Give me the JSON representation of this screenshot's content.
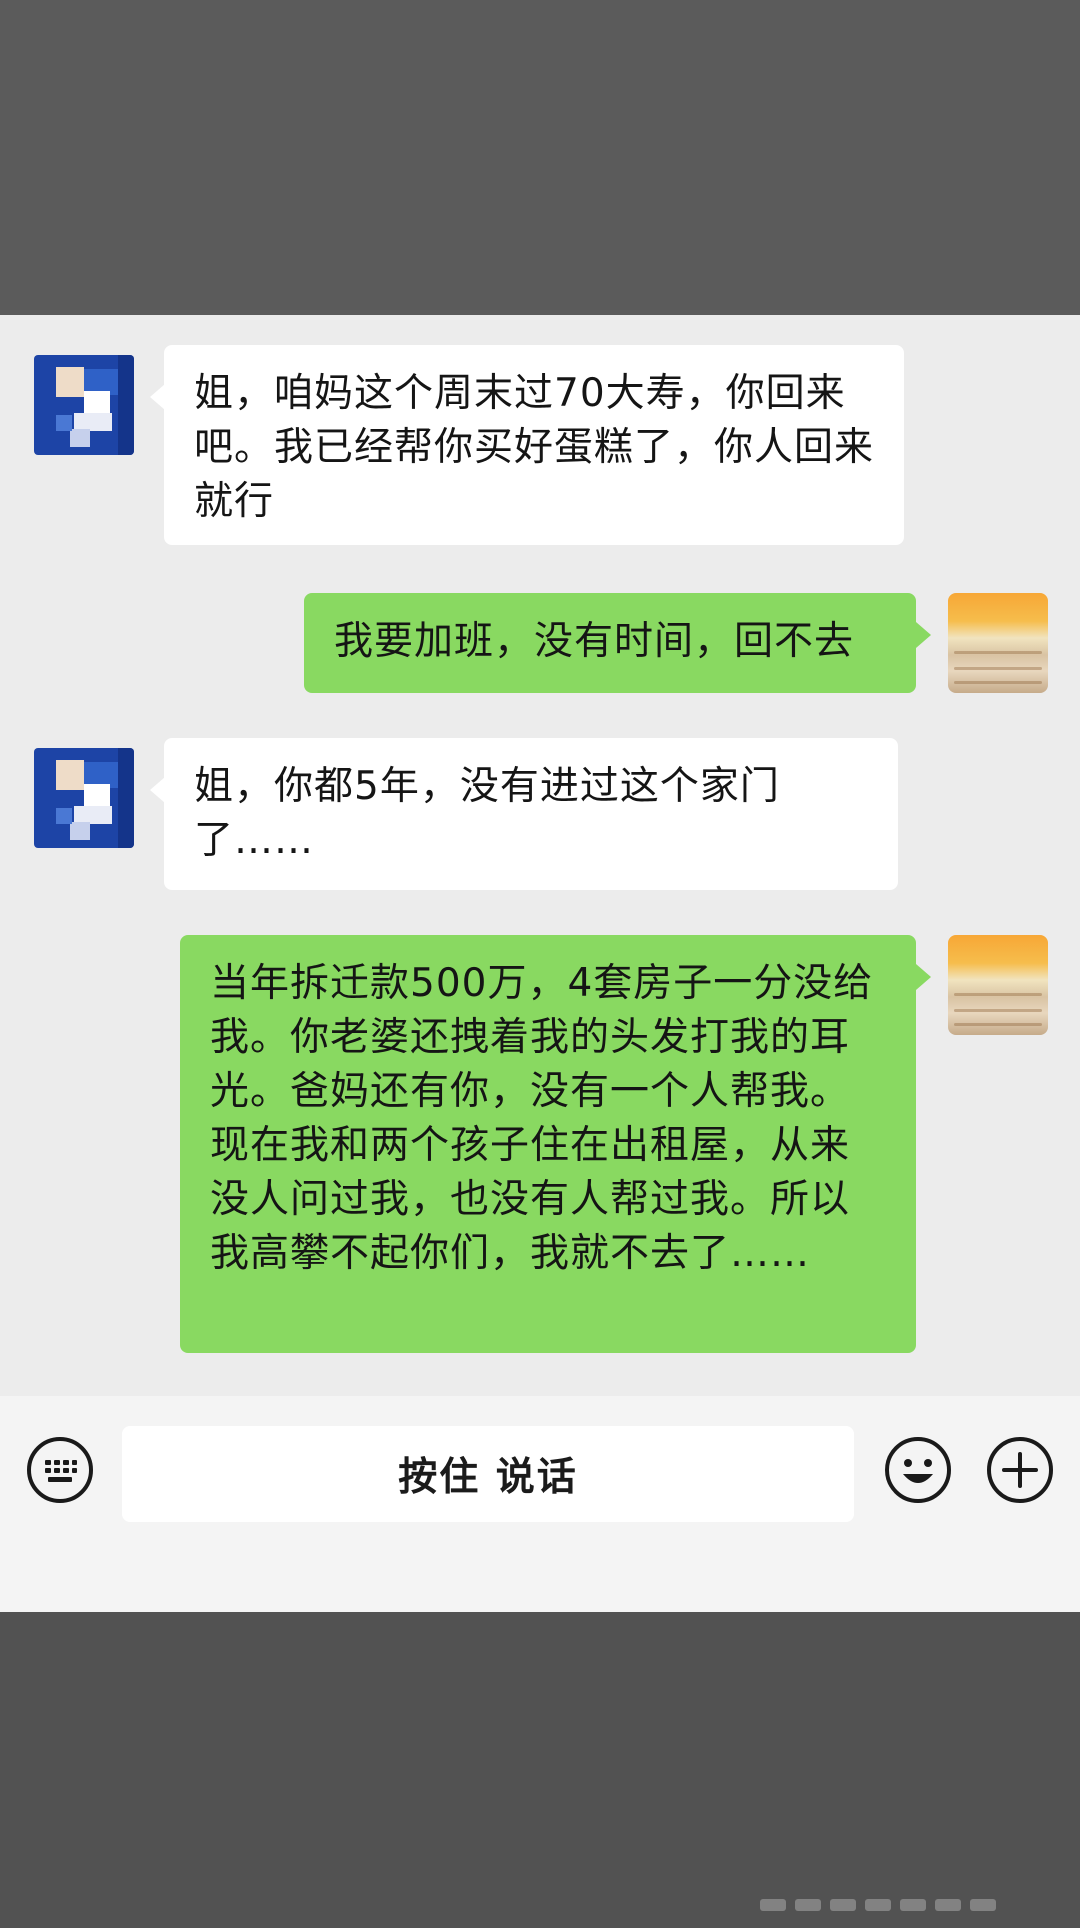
{
  "messages": [
    {
      "sender": "contact",
      "text": "姐，咱妈这个周末过70大寿，你回来吧。我已经帮你买好蛋糕了，你人回来就行"
    },
    {
      "sender": "self",
      "text": "我要加班，没有时间，回不去"
    },
    {
      "sender": "contact",
      "text": "姐，你都5年，没有进过这个家门了……"
    },
    {
      "sender": "self",
      "text": "当年拆迁款500万，4套房子一分没给我。你老婆还拽着我的头发打我的耳光。爸妈还有你，没有一个人帮我。现在我和两个孩子住在出租屋，从来没人问过我，也没有人帮过我。所以我高攀不起你们，我就不去了……"
    }
  ],
  "input_bar": {
    "voice_button_label": "按住 说话",
    "left_icon": "keyboard-icon",
    "right_icons": [
      "emoji-icon",
      "plus-icon"
    ]
  },
  "colors": {
    "incoming_bubble": "#ffffff",
    "outgoing_bubble": "#89d961",
    "chat_background": "#ececec",
    "contact_avatar": "#1d44a6"
  }
}
